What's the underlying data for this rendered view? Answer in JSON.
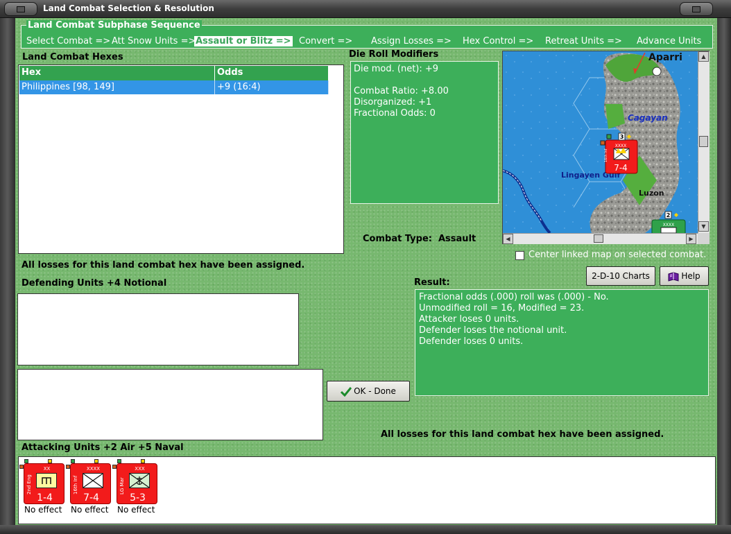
{
  "window": {
    "title": "Land Combat Selection & Resolution"
  },
  "sequence": {
    "title": "Land Combat Subphase Sequence",
    "steps": [
      {
        "label": "Select Combat =>"
      },
      {
        "label": "Att Snow Units =>"
      },
      {
        "label": "Assault or Blitz =>"
      },
      {
        "label": "Convert =>"
      },
      {
        "label": "Assign Losses =>"
      },
      {
        "label": "Hex Control =>"
      },
      {
        "label": "Retreat Units =>"
      },
      {
        "label": "Advance Units"
      }
    ],
    "active_step": "Assault or Blitz =>"
  },
  "hexes": {
    "heading": "Land Combat Hexes",
    "columns": [
      "Hex",
      "Odds"
    ],
    "rows": [
      {
        "hex": "Philippines [98, 149]",
        "odds": "+9 (16:4)"
      }
    ],
    "status": "All losses for this land combat hex have been assigned."
  },
  "modifiers": {
    "heading": "Die Roll Modifiers",
    "lines": [
      "Die mod. (net): +9",
      "",
      "Combat Ratio: +8.00",
      "Disorganized: +1",
      "Fractional Odds: 0"
    ],
    "combat_type_label": "Combat Type:",
    "combat_type_value": "Assault"
  },
  "map": {
    "labels": {
      "aparri": "Aparri",
      "cagayan": "Cagayan",
      "lingayen": "Lingayen Gulf",
      "luzon": "Luzon"
    },
    "unit": {
      "size": "XXXX",
      "name": "16th Inf",
      "strength": "7-4",
      "stack": "3"
    },
    "unit2": {
      "size": "XXXX",
      "stack": "2"
    },
    "center_linked_label": "Center linked map on selected combat.",
    "center_linked_checked": false
  },
  "buttons": {
    "charts": "2-D-10 Charts",
    "help": "Help",
    "ok": "OK - Done"
  },
  "defenders": {
    "heading": "Defending Units +4 Notional"
  },
  "result": {
    "heading": "Result:",
    "lines": [
      "Fractional odds (.000) roll was (.000)  - No.",
      "Unmodified roll = 16, Modified = 23.",
      "Attacker loses 0 units.",
      "Defender loses the notional unit.",
      "Defender loses 0 units."
    ],
    "status": "All losses for this land combat hex have been assigned."
  },
  "attackers": {
    "heading": "Attacking Units +2 Air +5 Naval",
    "units": [
      {
        "size": "XX",
        "name": "2nd Eng",
        "strength": "1-4",
        "type": "engineer",
        "result": "No effect"
      },
      {
        "size": "XXXX",
        "name": "16th Inf",
        "strength": "7-4",
        "type": "infantry",
        "result": "No effect"
      },
      {
        "size": "XXX",
        "name": "LG Mar",
        "strength": "5-3",
        "type": "marine",
        "result": "No effect"
      }
    ]
  },
  "colors": {
    "felt": "#77b86f",
    "panel_green": "#3daf5a",
    "header_green": "#33a24f",
    "selection": "#3395e6",
    "unit_red": "#f21b1b"
  }
}
